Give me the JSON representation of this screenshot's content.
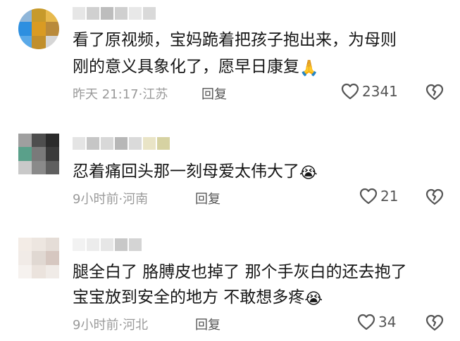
{
  "comments": [
    {
      "text_line1": "看了原视频，宝妈跪着把孩子抱出来，为母则",
      "text_line2": "刚的意义具象化了，愿早日康复",
      "emoji": "🙏",
      "time": "昨天 21:17",
      "location": "江苏",
      "reply_label": "回复",
      "likes": "2341"
    },
    {
      "text_line1": "忍着痛回头那一刻母爱太伟大了",
      "emoji": "😭",
      "time": "9小时前",
      "location": "河南",
      "reply_label": "回复",
      "likes": "21"
    },
    {
      "text_line1": "腿全白了 胳膊皮也掉了 那个手灰白的还去抱了",
      "text_line2": "宝宝放到安全的地方 不敢想多疼",
      "emoji": "😭",
      "time": "9小时前",
      "location": "河北",
      "reply_label": "回复",
      "likes": "34"
    }
  ],
  "colors": {
    "text": "#161616",
    "meta": "#9a9a9a",
    "icon": "#555555"
  },
  "icons": {
    "like": "heart-outline-icon",
    "dislike": "broken-heart-outline-icon"
  }
}
